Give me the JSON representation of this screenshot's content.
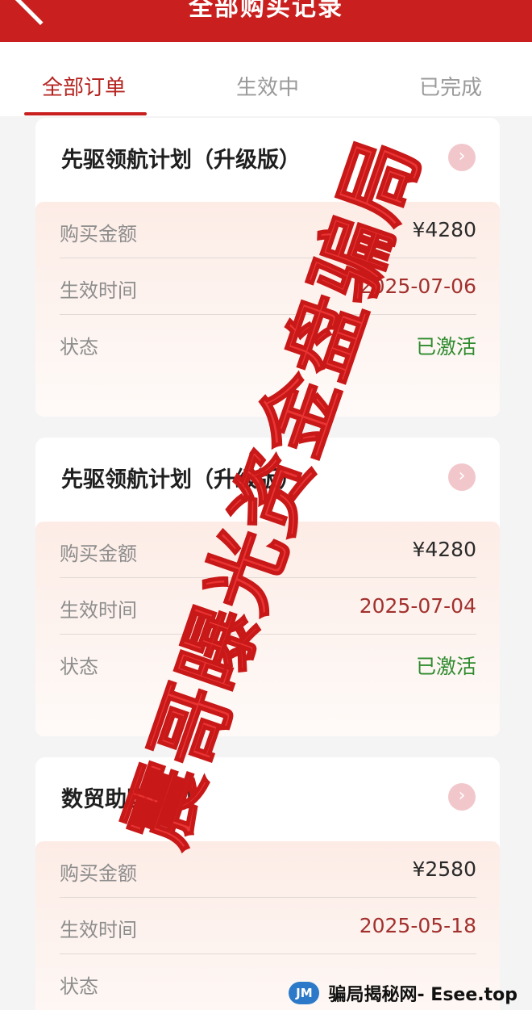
{
  "header": {
    "title": "全部购买记录",
    "back_icon": "chevron-left-icon"
  },
  "tabs": [
    {
      "label": "全部订单",
      "active": true
    },
    {
      "label": "生效中",
      "active": false
    },
    {
      "label": "已完成",
      "active": false
    }
  ],
  "orders": [
    {
      "title": "先驱领航计划（升级版）",
      "rows": [
        {
          "label": "购买金额",
          "value": "¥4280"
        },
        {
          "label": "生效时间",
          "value": "2025-07-06"
        },
        {
          "label": "状态",
          "value": "已激活"
        }
      ]
    },
    {
      "title": "先驱领航计划（升级版）",
      "rows": [
        {
          "label": "购买金额",
          "value": "¥4280"
        },
        {
          "label": "生效时间",
          "value": "2025-07-04"
        },
        {
          "label": "状态",
          "value": "已激活"
        }
      ]
    },
    {
      "title": "数贸助国计划",
      "rows": [
        {
          "label": "购买金额",
          "value": "¥2580"
        },
        {
          "label": "生效时间",
          "value": "2025-05-18"
        },
        {
          "label": "状态",
          "value": ""
        }
      ]
    }
  ],
  "watermark": {
    "text": "震哥曝光资金盘骗局"
  },
  "footer": {
    "logo": "JM",
    "text": "骗局揭秘网- Esee.top"
  },
  "colors": {
    "header_bg": "#c9201f",
    "active_tab": "#b5231f",
    "status_green": "#2e8b2e",
    "date_red": "#a2312e"
  }
}
